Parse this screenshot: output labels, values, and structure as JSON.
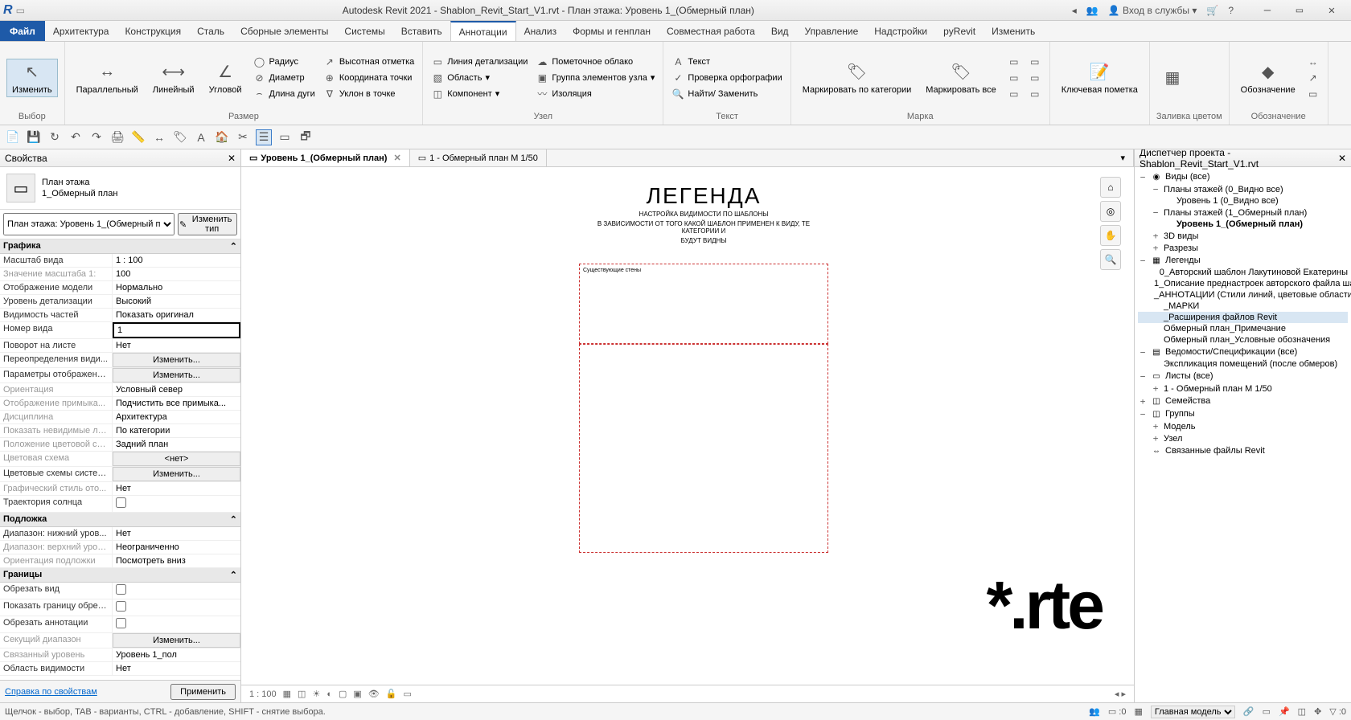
{
  "titlebar": {
    "title": "Autodesk Revit 2021 - Shablon_Revit_Start_V1.rvt - План этажа: Уровень 1_(Обмерный план)",
    "signin": "Вход в службы"
  },
  "menu": {
    "file": "Файл",
    "tabs": [
      "Архитектура",
      "Конструкция",
      "Сталь",
      "Сборные элементы",
      "Системы",
      "Вставить",
      "Аннотации",
      "Анализ",
      "Формы и генплан",
      "Совместная работа",
      "Вид",
      "Управление",
      "Надстройки",
      "pyRevit",
      "Изменить"
    ],
    "active": 6
  },
  "ribbon": {
    "select": {
      "modify": "Изменить",
      "label": "Выбор"
    },
    "dim": {
      "parallel": "Параллельный",
      "linear": "Линейный",
      "angular": "Угловой",
      "radius": "Радиус",
      "diameter": "Диаметр",
      "arc": "Длина дуги",
      "spot_elev": "Высотная отметка",
      "spot_coord": "Координата точки",
      "spot_slope": "Уклон  в точке",
      "label": "Размер"
    },
    "detail": {
      "detail_line": "Линия детализации",
      "region": "Область",
      "component": "Компонент",
      "cloud": "Пометочное облако",
      "group": "Группа элементов узла",
      "insulation": "Изоляция",
      "label": "Узел"
    },
    "text": {
      "text": "Текст",
      "spell": "Проверка  орфографии",
      "find": "Найти/ Заменить",
      "label": "Текст"
    },
    "tag": {
      "tag_cat": "Маркировать по категории",
      "tag_all": "Маркировать все",
      "label": "Марка"
    },
    "keynote": {
      "keynote": "Ключевая пометка"
    },
    "colorfill": {
      "label": "Заливка цветом"
    },
    "symbol": {
      "symbol": "Обозначение",
      "label": "Обозначение"
    }
  },
  "properties": {
    "title": "Свойства",
    "type_family": "План этажа",
    "type_name": "1_Обмерный план",
    "selector": "План этажа: Уровень 1_(Обмерный п",
    "edit_type": "Изменить тип",
    "groups": {
      "graphics": "Графика",
      "underlay": "Подложка",
      "extents": "Границы"
    },
    "rows": {
      "view_scale": {
        "k": "Масштаб вида",
        "v": "1 : 100"
      },
      "scale_value": {
        "k": "Значение масштаба    1:",
        "v": "100"
      },
      "model_disp": {
        "k": "Отображение модели",
        "v": "Нормально"
      },
      "detail_level": {
        "k": "Уровень детализации",
        "v": "Высокий"
      },
      "parts_vis": {
        "k": "Видимость частей",
        "v": "Показать оригинал"
      },
      "view_num": {
        "k": "Номер вида",
        "v": "1"
      },
      "rotation": {
        "k": "Поворот на листе",
        "v": "Нет"
      },
      "vg_over": {
        "k": "Переопределения види...",
        "v": "Изменить..."
      },
      "disp_opts": {
        "k": "Параметры отображени...",
        "v": "Изменить..."
      },
      "orientation": {
        "k": "Ориентация",
        "v": "Условный север"
      },
      "wall_join": {
        "k": "Отображение примыка...",
        "v": "Подчистить все примыка..."
      },
      "discipline": {
        "k": "Дисциплина",
        "v": "Архитектура"
      },
      "hidden_lines": {
        "k": "Показать невидимые ли...",
        "v": "По категории"
      },
      "color_loc": {
        "k": "Положение цветовой сх...",
        "v": "Задний план"
      },
      "color_scheme": {
        "k": "Цветовая схема",
        "v": "<нет>"
      },
      "sys_color": {
        "k": "Цветовые схемы системы",
        "v": "Изменить..."
      },
      "graphic_style": {
        "k": "Графический стиль ото...",
        "v": "Нет"
      },
      "sun_path": {
        "k": "Траектория солнца",
        "v": ""
      },
      "ul_bottom": {
        "k": "Диапазон: нижний уров...",
        "v": "Нет"
      },
      "ul_top": {
        "k": "Диапазон: верхний уров...",
        "v": "Неограниченно"
      },
      "ul_orient": {
        "k": "Ориентация подложки",
        "v": "Посмотреть вниз"
      },
      "crop_view": {
        "k": "Обрезать вид",
        "v": ""
      },
      "crop_vis": {
        "k": "Показать границу обрезки",
        "v": ""
      },
      "annot_crop": {
        "k": "Обрезать аннотации",
        "v": ""
      },
      "view_range": {
        "k": "Секущий диапазон",
        "v": "Изменить..."
      },
      "assoc_level": {
        "k": "Связанный уровень",
        "v": "Уровень 1_пол"
      },
      "scope_box": {
        "k": "Область видимости",
        "v": "Нет"
      }
    },
    "help": "Справка по свойствам",
    "apply": "Применить"
  },
  "view_tabs": {
    "active": "Уровень 1_(Обмерный план)",
    "inactive": "1 - Обмерный план М 1/50"
  },
  "legend": {
    "title": "ЛЕГЕНДА",
    "sub1": "НАСТРОЙКА ВИДИМОСТИ ПО ШАБЛОНЫ",
    "sub2": "В ЗАВИСИМОСТИ ОТ ТОГО КАКОЙ ШАБЛОН ПРИМЕНЕН К ВИДУ, ТЕ КАТЕГОРИИ И",
    "sub3": "БУДУТ ВИДНЫ",
    "box_title": "Существующие стены"
  },
  "watermark": "*.rte",
  "browser": {
    "title": "Диспетчер проекта - Shablon_Revit_Start_V1.rvt",
    "items": [
      {
        "lvl": 0,
        "tw": "−",
        "ico": "◉",
        "txt": "Виды (все)"
      },
      {
        "lvl": 1,
        "tw": "−",
        "txt": "Планы этажей (0_Видно все)"
      },
      {
        "lvl": 2,
        "tw": "",
        "txt": "Уровень 1 (0_Видно все)"
      },
      {
        "lvl": 1,
        "tw": "−",
        "txt": "Планы этажей (1_Обмерный план)"
      },
      {
        "lvl": 2,
        "tw": "",
        "txt": "Уровень 1_(Обмерный план)",
        "bold": true
      },
      {
        "lvl": 1,
        "tw": "+",
        "txt": "3D виды"
      },
      {
        "lvl": 1,
        "tw": "+",
        "txt": "Разрезы"
      },
      {
        "lvl": 0,
        "tw": "−",
        "ico": "▦",
        "txt": "Легенды"
      },
      {
        "lvl": 1,
        "tw": "",
        "txt": "0_Авторский шаблон Лакутиновой Екатерины"
      },
      {
        "lvl": 1,
        "tw": "",
        "txt": "1_Описание преднастроек авторского файла ша"
      },
      {
        "lvl": 1,
        "tw": "",
        "txt": "_АННОТАЦИИ (Стили линий, цветовые области"
      },
      {
        "lvl": 1,
        "tw": "",
        "txt": "_МАРКИ"
      },
      {
        "lvl": 1,
        "tw": "",
        "txt": "_Расширения файлов Revit",
        "sel": true
      },
      {
        "lvl": 1,
        "tw": "",
        "txt": "Обмерный план_Примечание"
      },
      {
        "lvl": 1,
        "tw": "",
        "txt": "Обмерный план_Условные обозначения"
      },
      {
        "lvl": 0,
        "tw": "−",
        "ico": "▤",
        "txt": "Ведомости/Спецификации (все)"
      },
      {
        "lvl": 1,
        "tw": "",
        "txt": "Экспликация помещений (после обмеров)"
      },
      {
        "lvl": 0,
        "tw": "−",
        "ico": "▭",
        "txt": "Листы (все)"
      },
      {
        "lvl": 1,
        "tw": "+",
        "txt": "1 - Обмерный план М 1/50"
      },
      {
        "lvl": 0,
        "tw": "+",
        "ico": "◫",
        "txt": "Семейства"
      },
      {
        "lvl": 0,
        "tw": "−",
        "ico": "◫",
        "txt": "Группы"
      },
      {
        "lvl": 1,
        "tw": "+",
        "txt": "Модель"
      },
      {
        "lvl": 1,
        "tw": "+",
        "txt": "Узел"
      },
      {
        "lvl": 0,
        "tw": "",
        "ico": "⇔",
        "txt": "Связанные файлы Revit"
      }
    ]
  },
  "viewbar": {
    "scale": "1 : 100"
  },
  "status": {
    "hint": "Щелчок - выбор, TAB - варианты, CTRL - добавление, SHIFT - снятие выбора.",
    "model": "Главная модель",
    "zero": ":0"
  }
}
